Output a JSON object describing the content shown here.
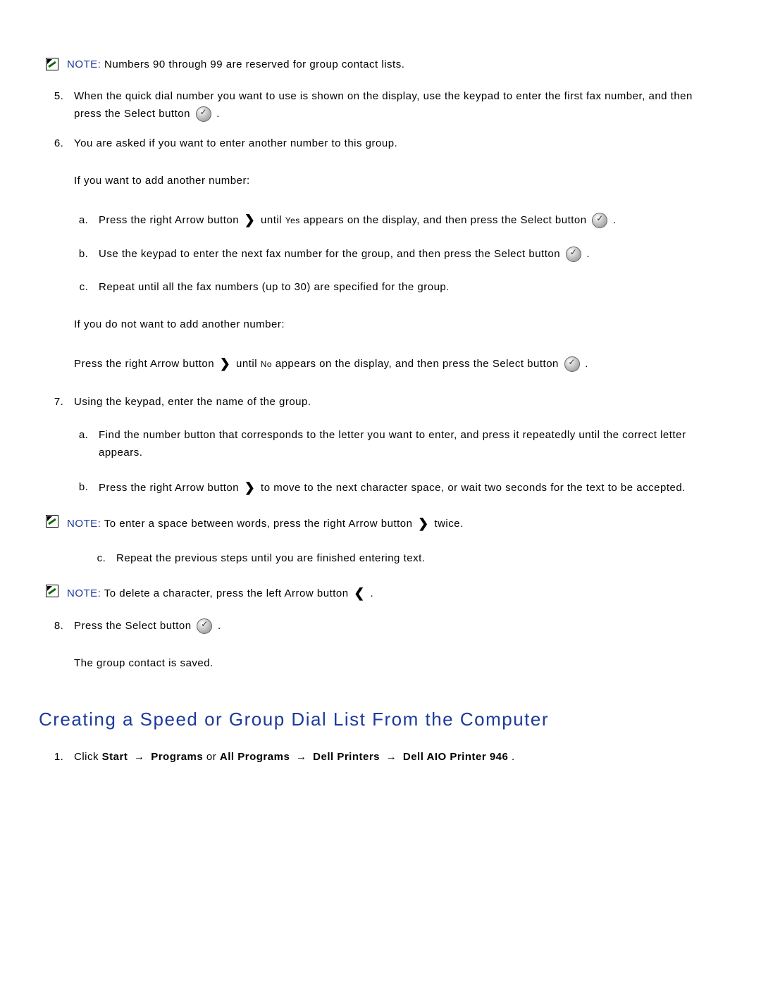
{
  "note1": {
    "label": "NOTE:",
    "text": "Numbers 90 through 99 are reserved for group contact lists."
  },
  "step5": "When the quick dial number you want to use is shown on the display, use the keypad to enter the first fax number, and then press the Select button ",
  "step5_end": " .",
  "step6": "You are asked if you want to enter another number to this group.",
  "if_add": "If you want to add another number:",
  "s6a_1": "Press the right Arrow button ",
  "s6a_2": " until ",
  "s6a_yes": "Yes",
  "s6a_3": " appears on the display, and then press the Select button ",
  "s6a_4": " .",
  "s6b_1": "Use the keypad to enter the next fax number for the group, and then press the Select button ",
  "s6b_2": " .",
  "s6c": "Repeat until all the fax numbers (up to 30) are specified for the group.",
  "if_not": "If you do not want to add another number:",
  "noadd_1": "Press the right Arrow button ",
  "noadd_2": " until ",
  "noadd_no": "No",
  "noadd_3": " appears on the display, and then press the Select button ",
  "noadd_4": " .",
  "step7": "Using the keypad, enter the name of the group.",
  "s7a": "Find the number button that corresponds to the letter you want to enter, and press it repeatedly until the correct letter appears.",
  "s7b_1": "Press the right Arrow button ",
  "s7b_2": " to move to the next character space, or wait two seconds for the text to be accepted.",
  "note2": {
    "label": "NOTE:",
    "t1": "To enter a space between words, press the right Arrow button ",
    "t2": " twice."
  },
  "s7c": "Repeat the previous steps until you are finished entering text.",
  "note3": {
    "label": "NOTE:",
    "t1": "To delete a character, press the left Arrow button ",
    "t2": " ."
  },
  "step8_1": "Press the Select button ",
  "step8_2": " .",
  "saved": "The group contact is saved.",
  "heading": "Creating a Speed or Group Dial List From the Computer",
  "comp1": {
    "pre": "Click ",
    "b1": "Start",
    "b2": " Programs",
    "or": " or ",
    "b3": "All Programs",
    "b4": " Dell Printers",
    "b5": " Dell AIO Printer 946",
    "end": "."
  },
  "arrow": "→",
  "arrow_right_glyph": "❯",
  "arrow_left_glyph": "❮"
}
